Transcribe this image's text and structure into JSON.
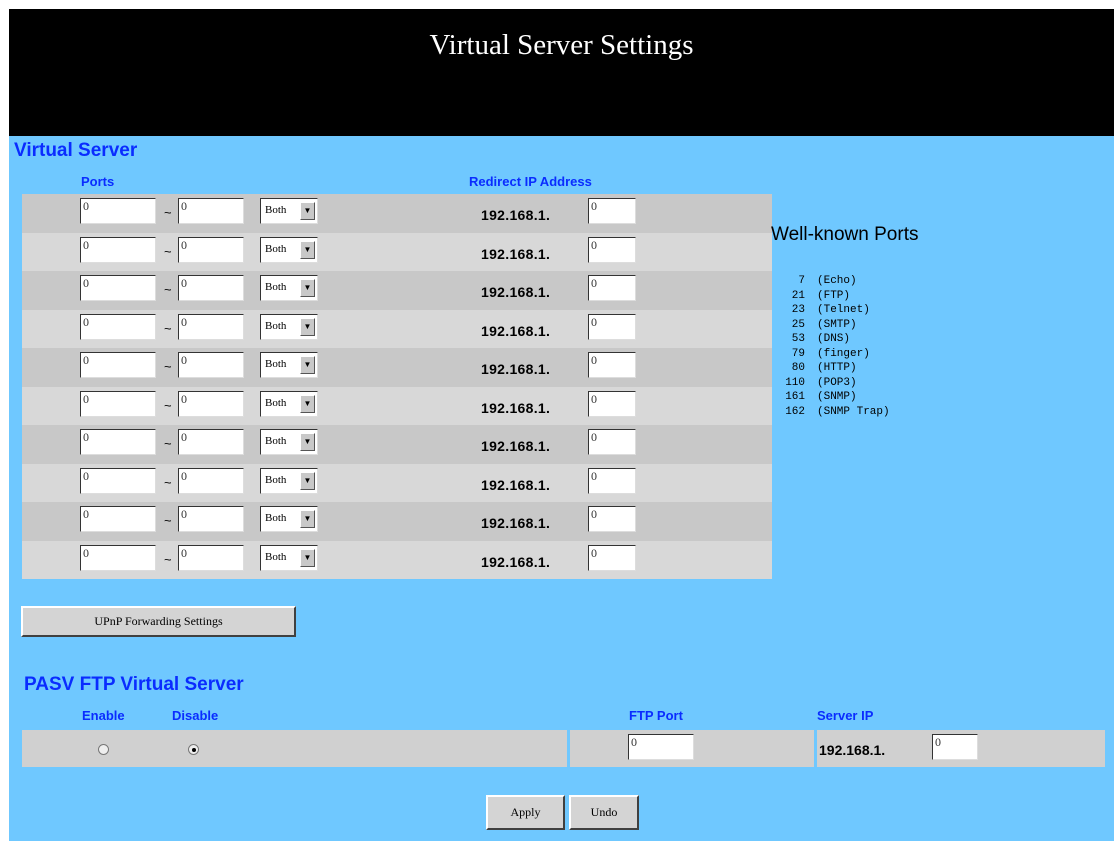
{
  "header": {
    "title": "Virtual Server Settings"
  },
  "virtual_server": {
    "title": "Virtual Server",
    "ports_label": "Ports",
    "redirect_label": "Redirect IP Address",
    "range_separator": "~",
    "ip_prefix": "192.168.1.",
    "rows": [
      {
        "port_start": "0",
        "port_end": "0",
        "protocol": "Both",
        "ip_last": "0"
      },
      {
        "port_start": "0",
        "port_end": "0",
        "protocol": "Both",
        "ip_last": "0"
      },
      {
        "port_start": "0",
        "port_end": "0",
        "protocol": "Both",
        "ip_last": "0"
      },
      {
        "port_start": "0",
        "port_end": "0",
        "protocol": "Both",
        "ip_last": "0"
      },
      {
        "port_start": "0",
        "port_end": "0",
        "protocol": "Both",
        "ip_last": "0"
      },
      {
        "port_start": "0",
        "port_end": "0",
        "protocol": "Both",
        "ip_last": "0"
      },
      {
        "port_start": "0",
        "port_end": "0",
        "protocol": "Both",
        "ip_last": "0"
      },
      {
        "port_start": "0",
        "port_end": "0",
        "protocol": "Both",
        "ip_last": "0"
      },
      {
        "port_start": "0",
        "port_end": "0",
        "protocol": "Both",
        "ip_last": "0"
      },
      {
        "port_start": "0",
        "port_end": "0",
        "protocol": "Both",
        "ip_last": "0"
      }
    ]
  },
  "well_known": {
    "title": "Well-known Ports",
    "items": [
      {
        "port": "7",
        "name": "(Echo)"
      },
      {
        "port": "21",
        "name": "(FTP)"
      },
      {
        "port": "23",
        "name": "(Telnet)"
      },
      {
        "port": "25",
        "name": "(SMTP)"
      },
      {
        "port": "53",
        "name": "(DNS)"
      },
      {
        "port": "79",
        "name": "(finger)"
      },
      {
        "port": "80",
        "name": "(HTTP)"
      },
      {
        "port": "110",
        "name": "(POP3)"
      },
      {
        "port": "161",
        "name": "(SNMP)"
      },
      {
        "port": "162",
        "name": "(SNMP Trap)"
      }
    ]
  },
  "upnp_button": "UPnP Forwarding Settings",
  "pasv": {
    "title": "PASV FTP Virtual Server",
    "enable_label": "Enable",
    "disable_label": "Disable",
    "selected": "Disable",
    "ftp_port_label": "FTP Port",
    "ftp_port": "0",
    "server_ip_label": "Server IP",
    "ip_prefix": "192.168.1.",
    "ip_last": "0"
  },
  "buttons": {
    "apply": "Apply",
    "undo": "Undo"
  }
}
